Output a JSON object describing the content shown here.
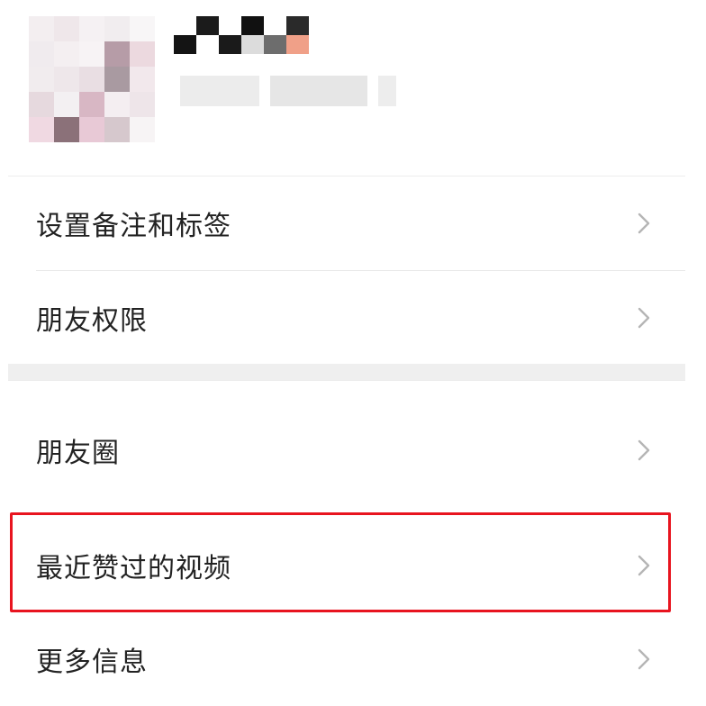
{
  "profile": {
    "avatar_colors": [
      "#f3eef0",
      "#efe7ea",
      "#f5f1f3",
      "#f1edef",
      "#f8f6f7",
      "#f0ebee",
      "#f4eff1",
      "#f7f3f5",
      "#b69ca7",
      "#ecd9df",
      "#f1ecee",
      "#eee7ea",
      "#e9dee3",
      "#a99aa1",
      "#f2e8ec",
      "#e6d9de",
      "#f3f0f2",
      "#d8b7c4",
      "#f4eef1",
      "#eee5e9",
      "#f0d9e2",
      "#8b7179",
      "#e8c9d6",
      "#d6c8cd",
      "#f7f4f5"
    ],
    "name_colors": [
      "#ffffff",
      "#1b1b1b",
      "#ffffff",
      "#111111",
      "#ffffff",
      "#2a2a2a",
      "#ffffff",
      "#141414",
      "#ffffff",
      "#1a1a1a",
      "#dcdcdc",
      "#6d6d6d",
      "#f0a088",
      "#ffffff"
    ],
    "subtext_colors": [
      "#ececec",
      "#e6e6e6",
      "#ededed"
    ]
  },
  "menu": {
    "group1": [
      {
        "label": "设置备注和标签"
      },
      {
        "label": "朋友权限"
      }
    ],
    "group2": [
      {
        "label": "朋友圈"
      },
      {
        "label": "最近赞过的视频"
      },
      {
        "label": "更多信息"
      }
    ]
  },
  "colors": {
    "highlight_border": "#e8141f",
    "chevron": "#b5b5b5",
    "text": "#222222"
  }
}
